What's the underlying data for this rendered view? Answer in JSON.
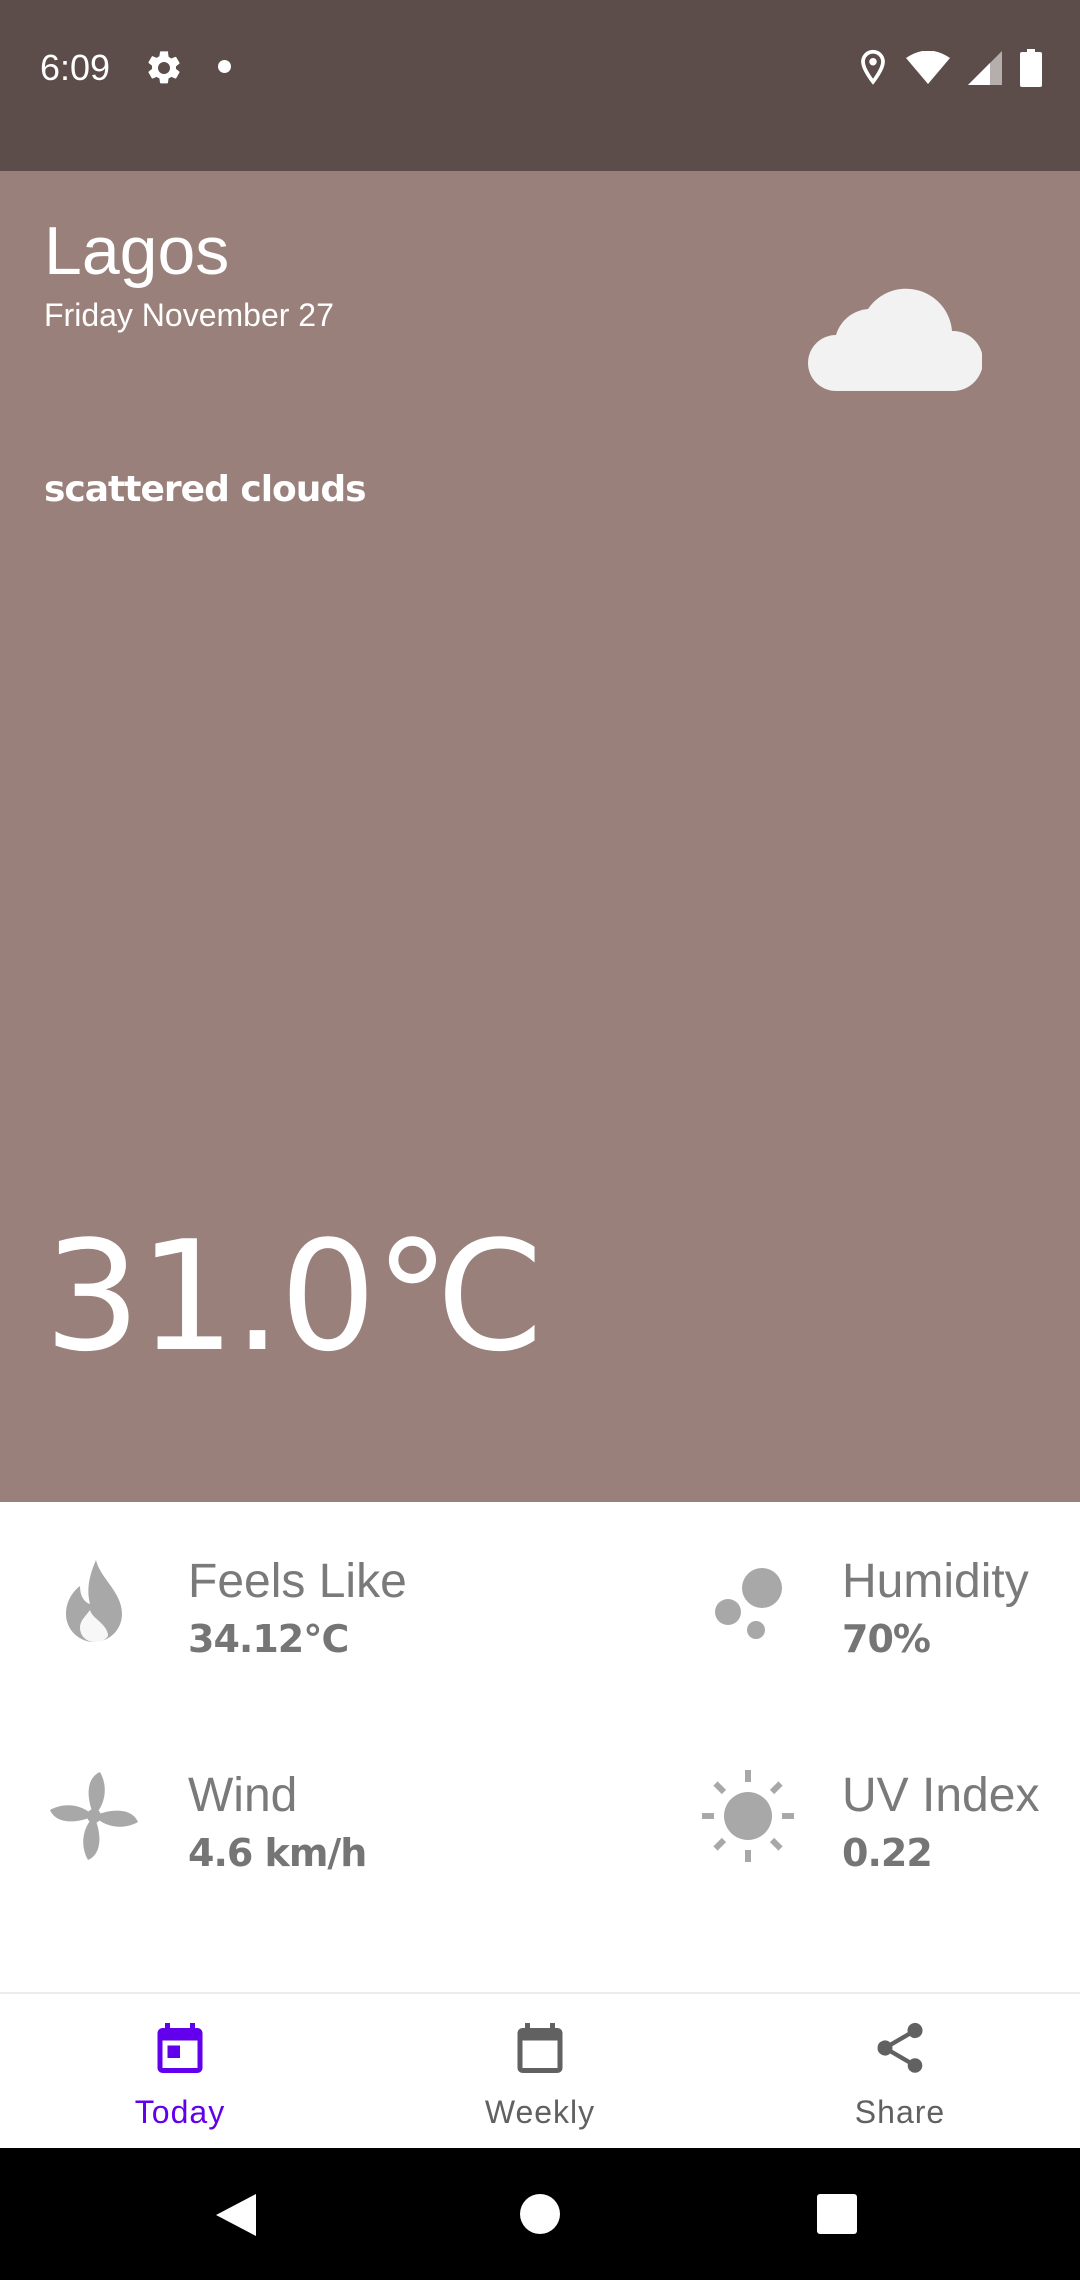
{
  "status_bar": {
    "time": "6:09",
    "icons": [
      "gear-icon",
      "dot-icon",
      "location-icon",
      "wifi-icon",
      "signal-icon",
      "battery-icon"
    ]
  },
  "weather": {
    "city": "Lagos",
    "date": "Friday November 27",
    "condition": "scattered clouds",
    "condition_icon": "cloud-icon",
    "temperature": "31.0℃"
  },
  "details": {
    "feels_like": {
      "label": "Feels Like",
      "value": "34.12℃",
      "icon": "flame-icon"
    },
    "humidity": {
      "label": "Humidity",
      "value": "70%",
      "icon": "droplets-icon"
    },
    "wind": {
      "label": "Wind",
      "value": "4.6 km/h",
      "icon": "fan-icon"
    },
    "uv_index": {
      "label": "UV Index",
      "value": "0.22",
      "icon": "sun-icon"
    }
  },
  "bottom_nav": {
    "items": [
      {
        "label": "Today",
        "icon": "calendar-today-icon",
        "selected": true
      },
      {
        "label": "Weekly",
        "icon": "calendar-icon",
        "selected": false
      },
      {
        "label": "Share",
        "icon": "share-icon",
        "selected": false
      }
    ]
  },
  "colors": {
    "status_bar": "#5c4d4b",
    "hero_background": "#9a807a",
    "accent": "#6200ee",
    "detail_icon": "#a8a8a8"
  }
}
